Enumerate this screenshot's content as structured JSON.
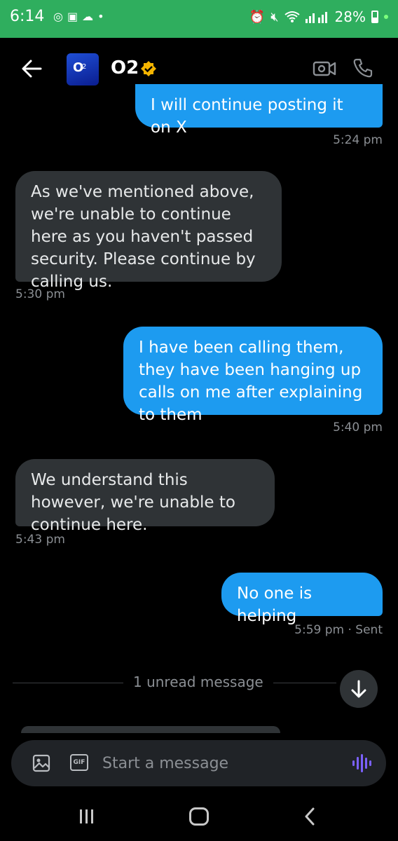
{
  "status_bar": {
    "time": "6:14",
    "battery": "28%"
  },
  "header": {
    "avatar_text": "O",
    "avatar_sub": "2",
    "contact_name": "O2",
    "verified_color": "#f4b400"
  },
  "messages": [
    {
      "direction": "sent",
      "text": "I will continue posting it on X",
      "time": "5:24 pm"
    },
    {
      "direction": "received",
      "text": "As we've mentioned above, we're unable to continue here as you haven't passed security. Please continue by calling us.",
      "time": "5:30 pm"
    },
    {
      "direction": "sent",
      "text": "I have been calling them, they have been hanging up calls on me after explaining to them",
      "time": "5:40 pm"
    },
    {
      "direction": "received",
      "text": "We understand this however, we're unable to continue here.",
      "time": "5:43 pm"
    },
    {
      "direction": "sent",
      "text": "No one is helping",
      "time": "5:59 pm · Sent"
    }
  ],
  "unread_divider": "1 unread message",
  "compose": {
    "gif_label": "GIF",
    "placeholder": "Start a message"
  },
  "colors": {
    "accent": "#1d9bf0",
    "status_bar": "#2fae5e",
    "voice_icon": "#7b61ff"
  }
}
